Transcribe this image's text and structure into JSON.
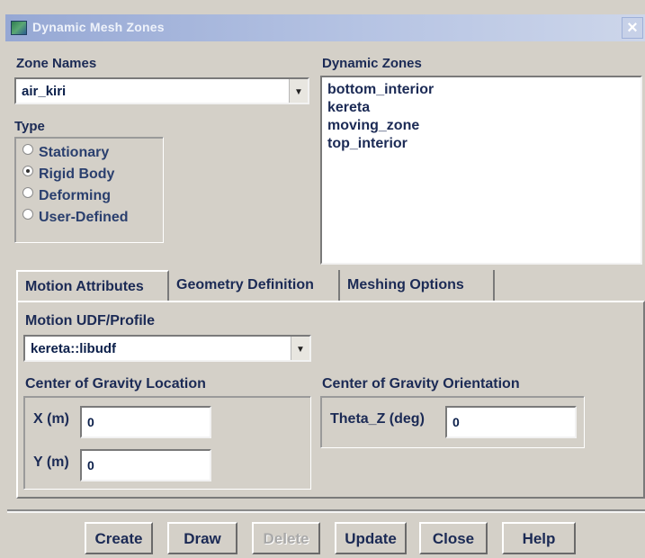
{
  "window": {
    "title": "Dynamic Mesh Zones",
    "close_glyph": "×"
  },
  "zone_names": {
    "label": "Zone Names",
    "selected": "air_kiri"
  },
  "type": {
    "label": "Type",
    "options": [
      {
        "label": "Stationary",
        "selected": false
      },
      {
        "label": "Rigid Body",
        "selected": true
      },
      {
        "label": "Deforming",
        "selected": false
      },
      {
        "label": "User-Defined",
        "selected": false
      }
    ]
  },
  "dynamic_zones": {
    "label": "Dynamic Zones",
    "items": [
      "bottom_interior",
      "kereta",
      "moving_zone",
      "top_interior"
    ]
  },
  "tabs": [
    {
      "label": "Motion Attributes",
      "active": true
    },
    {
      "label": "Geometry Definition",
      "active": false
    },
    {
      "label": "Meshing Options",
      "active": false
    }
  ],
  "motion": {
    "udf_label": "Motion UDF/Profile",
    "udf_selected": "kereta::libudf",
    "cog_location_label": "Center of Gravity Location",
    "x_label": "X (m)",
    "x_value": "0",
    "y_label": "Y (m)",
    "y_value": "0",
    "cog_orientation_label": "Center of Gravity Orientation",
    "theta_label": "Theta_Z (deg)",
    "theta_value": "0"
  },
  "buttons": {
    "create": "Create",
    "draw": "Draw",
    "delete": "Delete",
    "update": "Update",
    "close": "Close",
    "help": "Help"
  },
  "colors": {
    "titlebar_start": "#96a8d4",
    "window_bg": "#d4d0c8",
    "text": "#1b2a55",
    "disabled_text": "#a9a9a9"
  }
}
